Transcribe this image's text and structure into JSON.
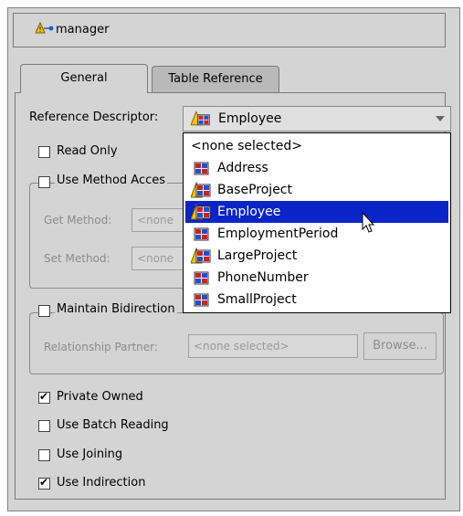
{
  "header": {
    "title": "manager",
    "icon": "attribute-warning-icon"
  },
  "tabs": [
    {
      "label": "General",
      "active": true
    },
    {
      "label": "Table Reference",
      "active": false
    }
  ],
  "reference_descriptor": {
    "label": "Reference Descriptor:",
    "value": "Employee"
  },
  "read_only": {
    "label": "Read Only",
    "checked": false
  },
  "method_access": {
    "label": "Use Method Acces",
    "checked": false,
    "get_label": "Get Method:",
    "get_value": "<none",
    "set_label": "Set Method:",
    "set_value": "<none"
  },
  "bidirectional": {
    "label": "Maintain Bidirection",
    "checked": false,
    "partner_label": "Relationship Partner:",
    "partner_value": "<none selected>",
    "browse_label": "Browse..."
  },
  "options": [
    {
      "label": "Private Owned",
      "checked": true
    },
    {
      "label": "Use Batch Reading",
      "checked": false
    },
    {
      "label": "Use Joining",
      "checked": false
    },
    {
      "label": "Use Indirection",
      "checked": true
    }
  ],
  "dropdown": {
    "items": [
      {
        "label": "<none selected>",
        "icon": "",
        "warning": false,
        "selected": false
      },
      {
        "label": "Address",
        "icon": "descriptor-icon",
        "warning": false,
        "selected": false
      },
      {
        "label": "BaseProject",
        "icon": "descriptor-icon",
        "warning": true,
        "selected": false
      },
      {
        "label": "Employee",
        "icon": "descriptor-icon",
        "warning": true,
        "selected": true
      },
      {
        "label": "EmploymentPeriod",
        "icon": "descriptor-icon",
        "warning": false,
        "selected": false
      },
      {
        "label": "LargeProject",
        "icon": "descriptor-icon",
        "warning": true,
        "selected": false
      },
      {
        "label": "PhoneNumber",
        "icon": "descriptor-icon",
        "warning": false,
        "selected": false
      },
      {
        "label": "SmallProject",
        "icon": "descriptor-icon",
        "warning": false,
        "selected": false
      }
    ]
  },
  "colors": {
    "selection": "#0a24c8",
    "background": "#d4d4d4"
  }
}
